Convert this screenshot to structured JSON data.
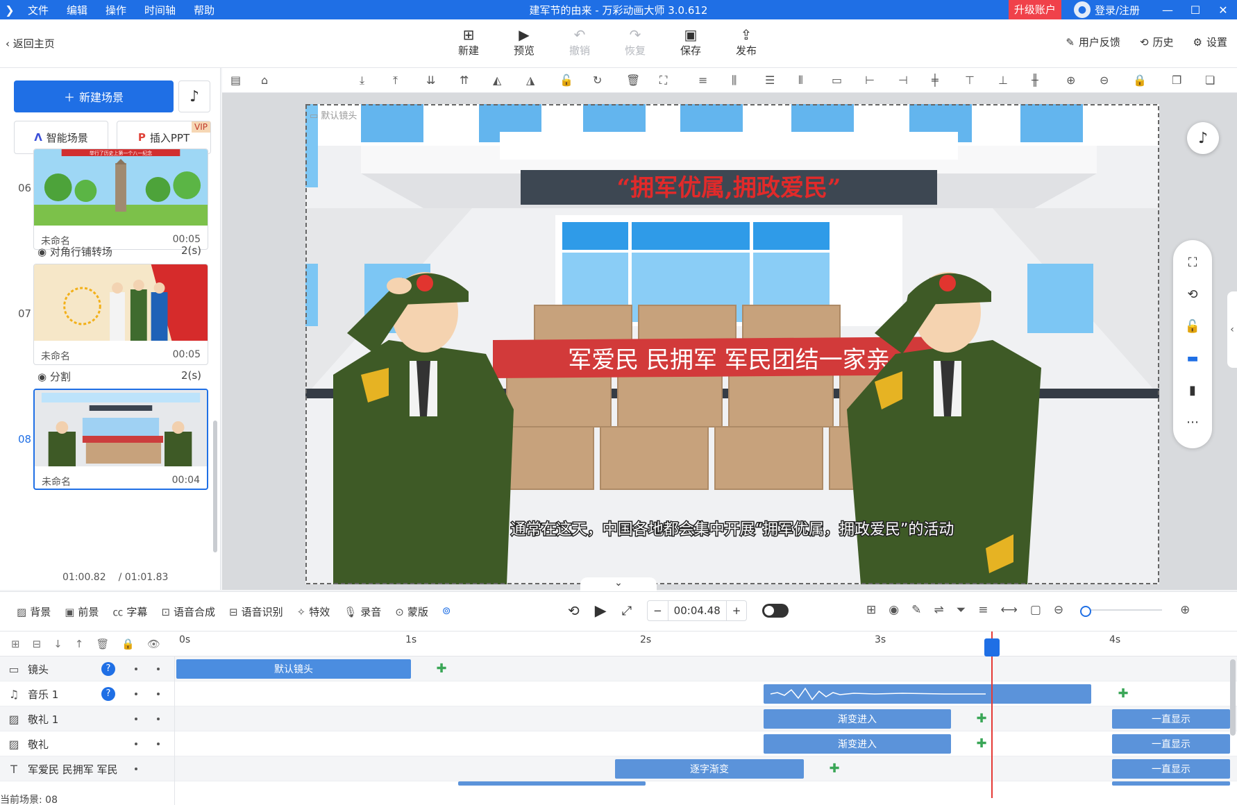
{
  "titlebar": {
    "menu": [
      "文件",
      "编辑",
      "操作",
      "时间轴",
      "帮助"
    ],
    "title": "建军节的由来 - 万彩动画大师 3.0.612",
    "upgrade": "升级账户",
    "login": "登录/注册"
  },
  "toolbar": {
    "back": "返回主页",
    "tools": [
      {
        "label": "新建",
        "icon": "new-icon"
      },
      {
        "label": "预览",
        "icon": "play-icon"
      },
      {
        "label": "撤销",
        "icon": "undo-icon"
      },
      {
        "label": "恢复",
        "icon": "redo-icon"
      },
      {
        "label": "保存",
        "icon": "save-icon"
      },
      {
        "label": "发布",
        "icon": "publish-icon"
      }
    ],
    "right": [
      "用户反馈",
      "历史",
      "设置"
    ]
  },
  "left": {
    "new_scene": "新建场景",
    "smart_scene": "智能场景",
    "insert_ppt": "插入PPT",
    "vip": "VIP",
    "scenes": [
      {
        "num": "06",
        "name": "未命名",
        "duration": "00:05"
      },
      {
        "num": "07",
        "name": "未命名",
        "duration": "00:05"
      },
      {
        "num": "08",
        "name": "未命名",
        "duration": "00:04"
      }
    ],
    "transitions": [
      {
        "name": "对角行铺转场",
        "duration": "2(s)"
      },
      {
        "name": "分割",
        "duration": "2(s)"
      }
    ],
    "time_current": "01:00.82",
    "time_total": "/ 01:01.83"
  },
  "canvas": {
    "camera_label": "默认镜头",
    "banner_top": "“拥军优属,拥政爱民”",
    "banner_red": "军爱民 民拥军 军民团结一家亲",
    "subtitle": "通常在这天，中国各地都会集中开展“拥军优属，拥政爱民”的活动",
    "thumb06_text": "举行了历史上第一个八一纪念"
  },
  "bottom": {
    "tools": [
      "背景",
      "前景",
      "字幕",
      "语音合成",
      "语音识别",
      "特效",
      "录音",
      "蒙版"
    ],
    "time_value": "00:04.48",
    "minus": "−",
    "plus": "+"
  },
  "timeline": {
    "ruler": [
      "0s",
      "1s",
      "2s",
      "3s",
      "4s"
    ],
    "tracks": [
      {
        "name": "镜头",
        "icon": "camera-icon"
      },
      {
        "name": "音乐 1",
        "icon": "music-icon"
      },
      {
        "name": "敬礼 1",
        "icon": "image-icon"
      },
      {
        "name": "敬礼",
        "icon": "image-icon"
      },
      {
        "name": "军爱民 民拥军 军民",
        "icon": "text-icon"
      }
    ],
    "clips": {
      "camera": "默认镜头",
      "fade_in": "渐变进入",
      "always": "一直显示",
      "char_fade": "逐字渐变"
    },
    "status": "当前场景: 08"
  },
  "colors": {
    "accent": "#1f6fe5",
    "upgrade": "#f0414a",
    "keyframe": "#3aa657",
    "playhead": "#e53935"
  }
}
